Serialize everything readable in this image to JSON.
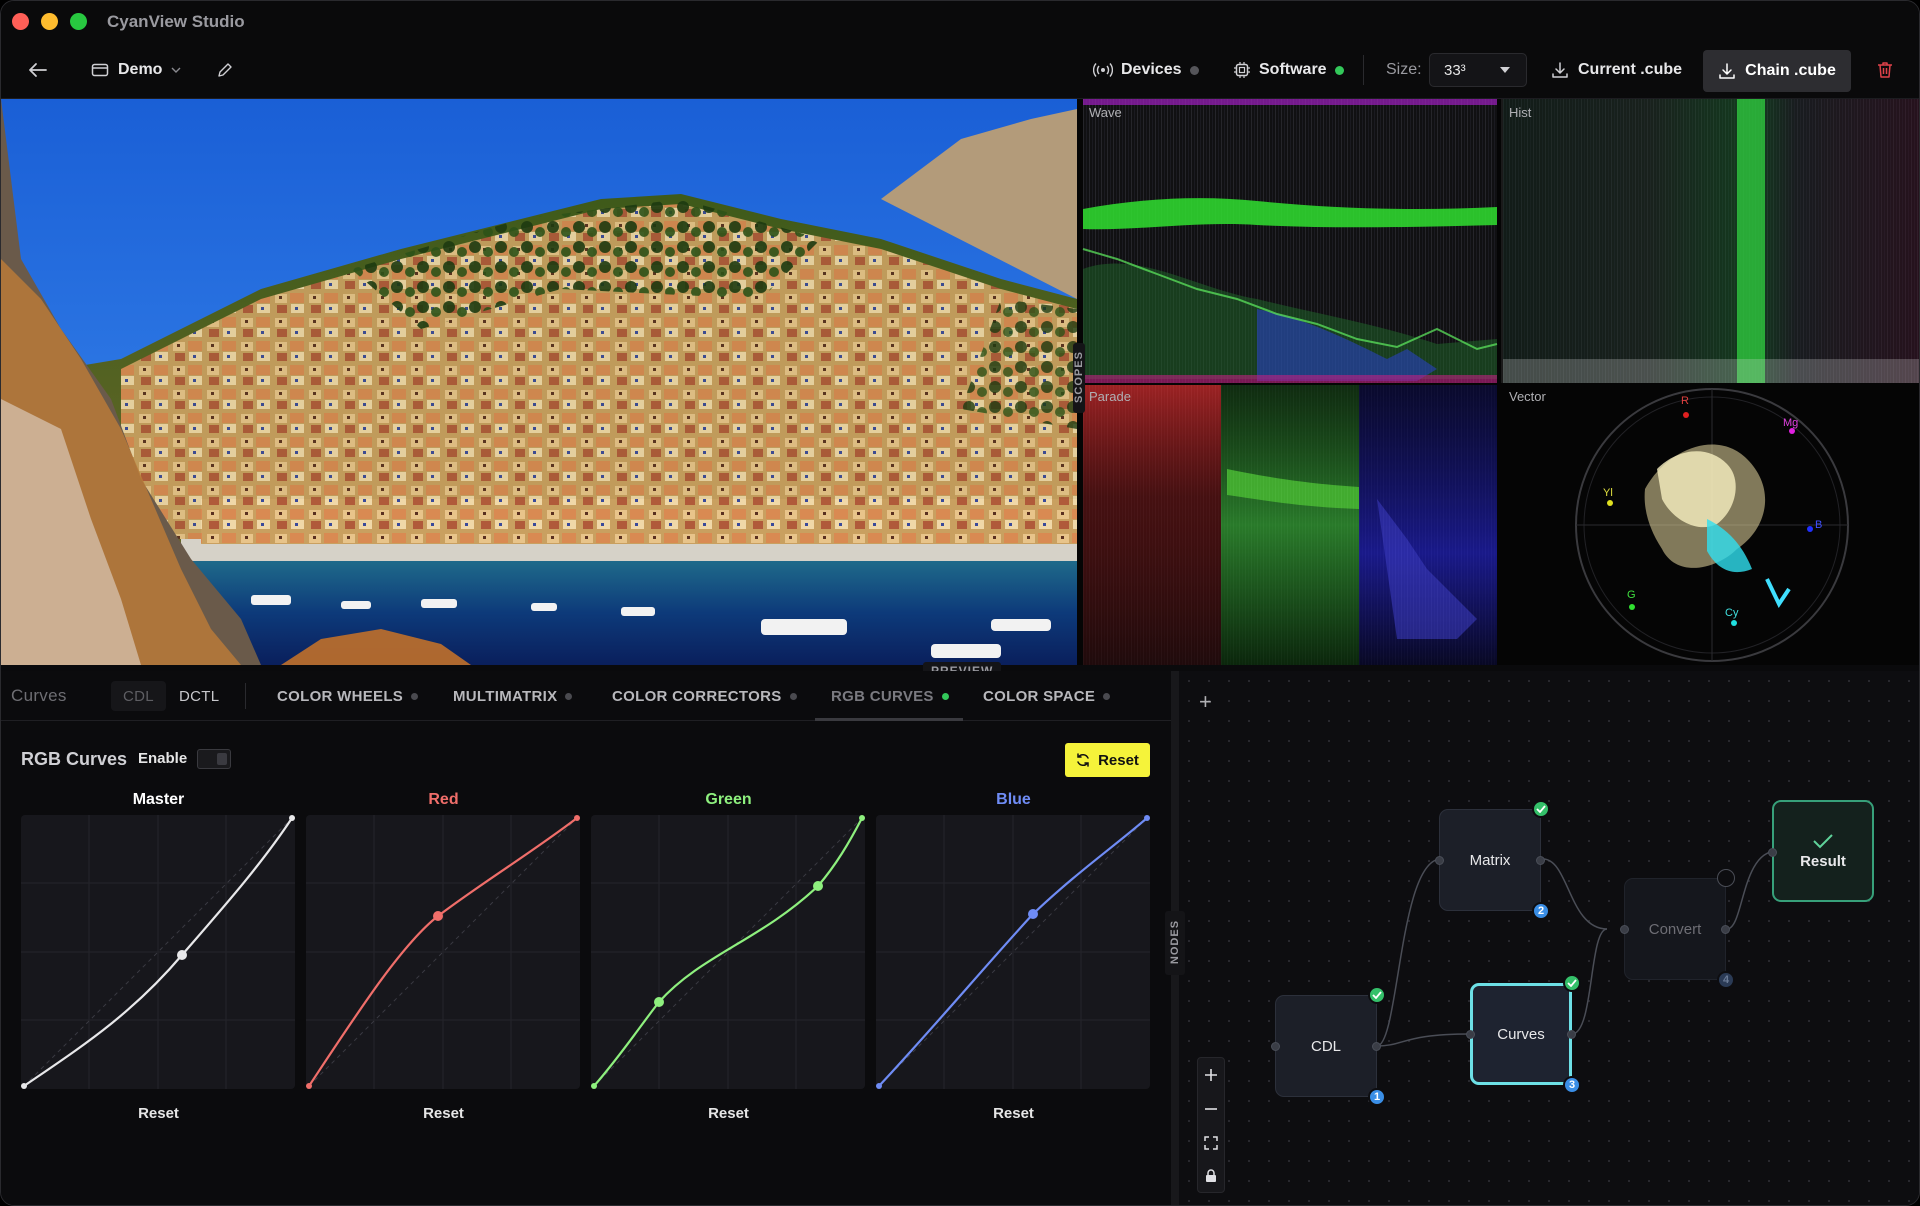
{
  "window": {
    "title": "CyanView Studio"
  },
  "toolbar": {
    "project": "Demo",
    "devices": "Devices",
    "software": "Software",
    "size_label": "Size:",
    "size_value": "33³",
    "current_cube": "Current .cube",
    "chain_cube": "Chain .cube"
  },
  "preview": {
    "label": "PREVIEW"
  },
  "scopes": {
    "tab_label": "SCOPES",
    "wave": "Wave",
    "hist": "Hist",
    "parade": "Parade",
    "vector": "Vector",
    "vector_targets": [
      "R",
      "Mg",
      "Yl",
      "B",
      "G",
      "Cy"
    ]
  },
  "tabs": {
    "curves": "Curves",
    "cdl": "CDL",
    "dctl": "DCTL",
    "items": [
      {
        "label": "COLOR WHEELS",
        "status": "off"
      },
      {
        "label": "MULTIMATRIX",
        "status": "off"
      },
      {
        "label": "COLOR CORRECTORS",
        "status": "off"
      },
      {
        "label": "RGB CURVES",
        "status": "on"
      },
      {
        "label": "COLOR SPACE",
        "status": "off"
      }
    ]
  },
  "rgb_curves": {
    "title": "RGB Curves",
    "enable_label": "Enable",
    "enabled": false,
    "reset_label": "Reset",
    "curves": [
      {
        "name": "Master",
        "color": "#e8e8ea",
        "control_point": [
          0.58,
          0.49
        ],
        "reset": "Reset"
      },
      {
        "name": "Red",
        "color": "#f06e6a",
        "control_point": [
          0.48,
          0.63
        ],
        "reset": "Reset"
      },
      {
        "name": "Green",
        "color": "#8ef07e",
        "control_point_1": [
          0.25,
          0.32
        ],
        "control_point_2": [
          0.83,
          0.74
        ],
        "reset": "Reset"
      },
      {
        "name": "Blue",
        "color": "#6f8cf5",
        "control_point": [
          0.57,
          0.64
        ],
        "reset": "Reset"
      }
    ]
  },
  "nodes": {
    "tab_label": "NODES",
    "items": [
      {
        "label": "CDL",
        "badge": "1",
        "ok": true
      },
      {
        "label": "Matrix",
        "badge": "2",
        "ok": true
      },
      {
        "label": "Curves",
        "badge": "3",
        "ok": true,
        "selected": true
      },
      {
        "label": "Convert",
        "badge": "4",
        "ok": false
      },
      {
        "label": "Result",
        "ok": true
      }
    ]
  },
  "colors": {
    "accent_yellow": "#f5f33a",
    "status_green": "#33c85a",
    "selection_cyan": "#6de0e6",
    "badge_blue": "#3a8ee6"
  }
}
